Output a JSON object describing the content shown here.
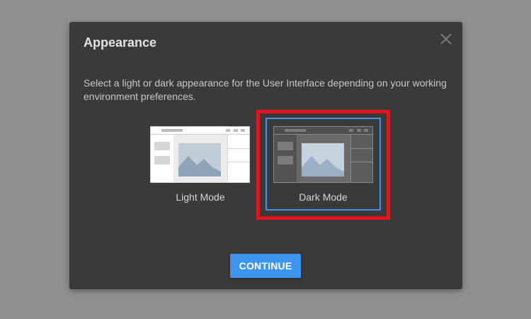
{
  "dialog": {
    "title": "Appearance",
    "description": "Select a light or dark appearance for the User Interface depending on your working environment preferences.",
    "close_icon": "close-icon",
    "options": [
      {
        "label": "Light Mode",
        "selected": false,
        "icon": "light-mode-preview"
      },
      {
        "label": "Dark Mode",
        "selected": true,
        "icon": "dark-mode-preview"
      }
    ],
    "continue_label": "CONTINUE"
  },
  "colors": {
    "overlay": "#8f8f8f",
    "dialog_bg": "#3a3a3a",
    "accent": "#3d95f0",
    "selection_border": "#4a90e2",
    "highlight": "#e0161f"
  }
}
